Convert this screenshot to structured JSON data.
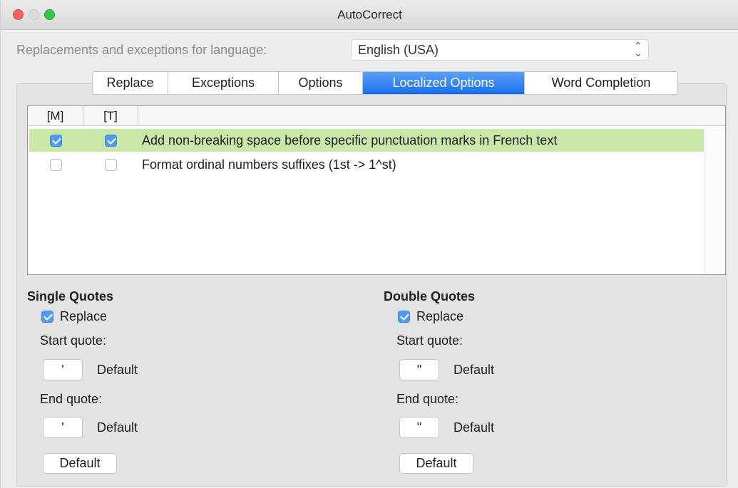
{
  "window": {
    "title": "AutoCorrect"
  },
  "language": {
    "label": "Replacements and exceptions for language:",
    "value": "English (USA)"
  },
  "tabs": [
    {
      "label": "Replace",
      "active": false
    },
    {
      "label": "Exceptions",
      "active": false
    },
    {
      "label": "Options",
      "active": false
    },
    {
      "label": "Localized Options",
      "active": true
    },
    {
      "label": "Word Completion",
      "active": false
    }
  ],
  "list": {
    "headers": {
      "m": "[M]",
      "t": "[T]"
    },
    "rows": [
      {
        "m": true,
        "t": true,
        "text": "Add non-breaking space before specific punctuation marks in French text",
        "selected": true
      },
      {
        "m": false,
        "t": false,
        "text": "Format ordinal numbers suffixes (1st -> 1^st)",
        "selected": false
      }
    ]
  },
  "single_quotes": {
    "heading": "Single Quotes",
    "replace_label": "Replace",
    "replace_checked": true,
    "start_label": "Start quote:",
    "start_char": "'",
    "start_default": "Default",
    "end_label": "End quote:",
    "end_char": "'",
    "end_default": "Default",
    "default_button": "Default"
  },
  "double_quotes": {
    "heading": "Double Quotes",
    "replace_label": "Replace",
    "replace_checked": true,
    "start_label": "Start quote:",
    "start_char": "\"",
    "start_default": "Default",
    "end_label": "End quote:",
    "end_char": "\"",
    "end_default": "Default",
    "default_button": "Default"
  },
  "colors": {
    "accent": "#1a6ff1",
    "selected_row": "#c9e8a8",
    "checkbox_checked": "#4f9cf7"
  }
}
